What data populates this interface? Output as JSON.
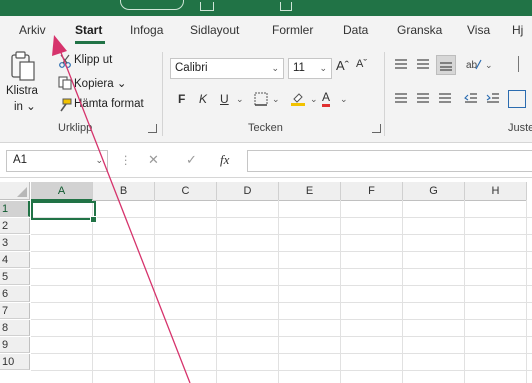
{
  "tabs": [
    {
      "label": "Arkiv"
    },
    {
      "label": "Start"
    },
    {
      "label": "Infoga"
    },
    {
      "label": "Sidlayout"
    },
    {
      "label": "Formler"
    },
    {
      "label": "Data"
    },
    {
      "label": "Granska"
    },
    {
      "label": "Visa"
    },
    {
      "label": "Hj"
    }
  ],
  "clipboard": {
    "paste_label": "Klistra",
    "paste_sub": "in ⌄",
    "cut_label": "Klipp ut",
    "copy_label": "Kopiera ⌄",
    "format_painter_label": "Hämta format",
    "group_label": "Urklipp"
  },
  "font": {
    "font_name": "Calibri",
    "font_size": "11",
    "grow_label": "Aˆ",
    "shrink_label": "Aˇ",
    "bold": "F",
    "italic": "K",
    "underline": "U",
    "font_color": "A",
    "group_label": "Tecken"
  },
  "alignment": {
    "group_label": "Juste"
  },
  "formula_bar": {
    "name_box": "A1",
    "fx": "fx",
    "cancel": "✕",
    "enter": "✓",
    "more": "⋮",
    "formula": ""
  },
  "grid": {
    "columns": [
      "A",
      "B",
      "C",
      "D",
      "E",
      "F",
      "G",
      "H"
    ],
    "rows": [
      "1",
      "2",
      "3",
      "4",
      "5",
      "6",
      "7",
      "8",
      "9",
      "10"
    ],
    "selected_cell": "A1"
  },
  "colors": {
    "accent": "#217346",
    "annotation": "#d6336c"
  }
}
